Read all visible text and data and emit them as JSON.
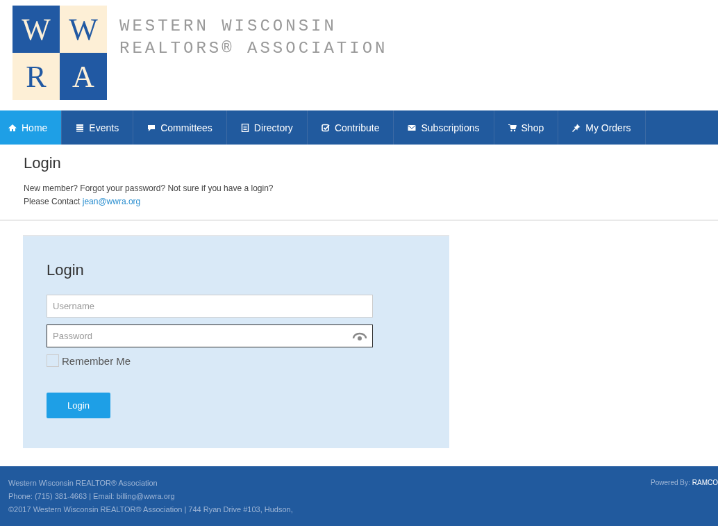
{
  "logo": {
    "letters": [
      "W",
      "W",
      "R",
      "A"
    ],
    "name_lines": [
      "WESTERN WISCONSIN",
      "REALTORS® ASSOCIATION"
    ]
  },
  "nav": [
    {
      "label": "Home",
      "selected": true
    },
    {
      "label": "Events",
      "selected": false
    },
    {
      "label": "Committees",
      "selected": false
    },
    {
      "label": "Directory",
      "selected": false
    },
    {
      "label": "Contribute",
      "selected": false
    },
    {
      "label": "Subscriptions",
      "selected": false
    },
    {
      "label": "Shop",
      "selected": false
    },
    {
      "label": "My Orders",
      "selected": false
    }
  ],
  "page": {
    "title": "Login",
    "intro": "New member? Forgot your password? Not sure if you have a login?",
    "contact_prefix": "Please Contact",
    "contact_link": "jean@wwra.org"
  },
  "login_form": {
    "title": "Login",
    "username": {
      "placeholder": "Username"
    },
    "password": {
      "placeholder": "Password"
    },
    "remember": {
      "label": "Remember Me",
      "checked": false
    },
    "button": "Login"
  },
  "footer": {
    "lines": [
      "Western Wisconsin REALTOR® Association",
      "Phone: (715) 381-4663 | Email: billing@wwra.org",
      "©2017 Western Wisconsin REALTOR® Association | 744 Ryan Drive #103, Hudson,"
    ],
    "powered_label": "Powered By:",
    "powered_name": "RAMCO"
  }
}
